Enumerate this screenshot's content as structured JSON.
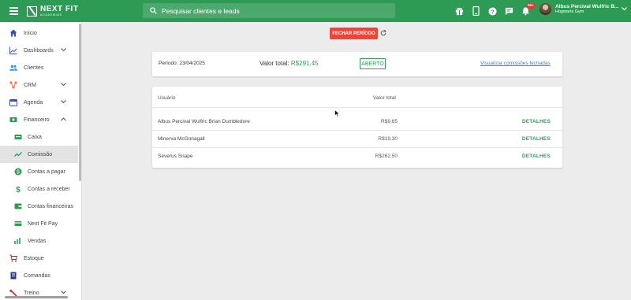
{
  "header": {
    "logo_main": "NEXT FIT",
    "logo_sub": "ACADEMIAS",
    "search_placeholder": "Pesquisar clientes e leads",
    "notifications_badge": "99+",
    "user_name": "Albus Percival Wulfric B...",
    "user_gym": "Hogwarts Gym",
    "icons": [
      "gift-icon",
      "mobile-icon",
      "help-icon",
      "chat-icon",
      "bell-icon"
    ]
  },
  "sidebar": {
    "items": [
      {
        "label": "Início",
        "icon": "home-icon"
      },
      {
        "label": "Dashboards",
        "icon": "chart-icon",
        "expandable": true
      },
      {
        "label": "Clientes",
        "icon": "people-icon"
      },
      {
        "label": "CRM",
        "icon": "crm-icon",
        "expandable": true
      },
      {
        "label": "Agenda",
        "icon": "calendar-icon",
        "expandable": true
      },
      {
        "label": "Financeiro",
        "icon": "money-icon",
        "expandable": true,
        "expanded": true
      },
      {
        "label": "Caixa",
        "icon": "cash-icon",
        "sub": true
      },
      {
        "label": "Comissão",
        "icon": "trend-icon",
        "sub": true,
        "active": true
      },
      {
        "label": "Contas a pagar",
        "icon": "coin-icon",
        "sub": true
      },
      {
        "label": "Contas a receber",
        "icon": "dollar-icon",
        "sub": true
      },
      {
        "label": "Contas financeiras",
        "icon": "wallet-icon",
        "sub": true
      },
      {
        "label": "Next Fit Pay",
        "icon": "card-icon",
        "sub": true
      },
      {
        "label": "Vendas",
        "icon": "sales-icon",
        "sub": true
      },
      {
        "label": "Estoque",
        "icon": "cart-icon"
      },
      {
        "label": "Comandas",
        "icon": "receipt-icon"
      },
      {
        "label": "Treino",
        "icon": "dumbbell-icon",
        "expandable": true
      }
    ]
  },
  "main": {
    "close_period_label": "FECHAR PERÍODO",
    "summary": {
      "periodo": "Período: 23/04/2025",
      "valor_total_label": "Valor total:",
      "valor_total_amount": "R$291,45",
      "status": "ABERTO",
      "link_label": "Visualizar comissões fechadas"
    },
    "table": {
      "headers": {
        "usuario": "Usuário",
        "valor_total": "Valor total"
      },
      "rows": [
        {
          "name": "Albus Percival Wulfric Brian Dumbledore",
          "value": "R$9,65",
          "action": "DETALHES"
        },
        {
          "name": "Minerva McGonagall",
          "value": "R$19,30",
          "action": "DETALHES"
        },
        {
          "name": "Severus Snape",
          "value": "R$262,50",
          "action": "DETALHES"
        }
      ]
    }
  },
  "colors": {
    "brand": "#2e9b55",
    "danger": "#f44336",
    "link": "#3f7fbf"
  }
}
